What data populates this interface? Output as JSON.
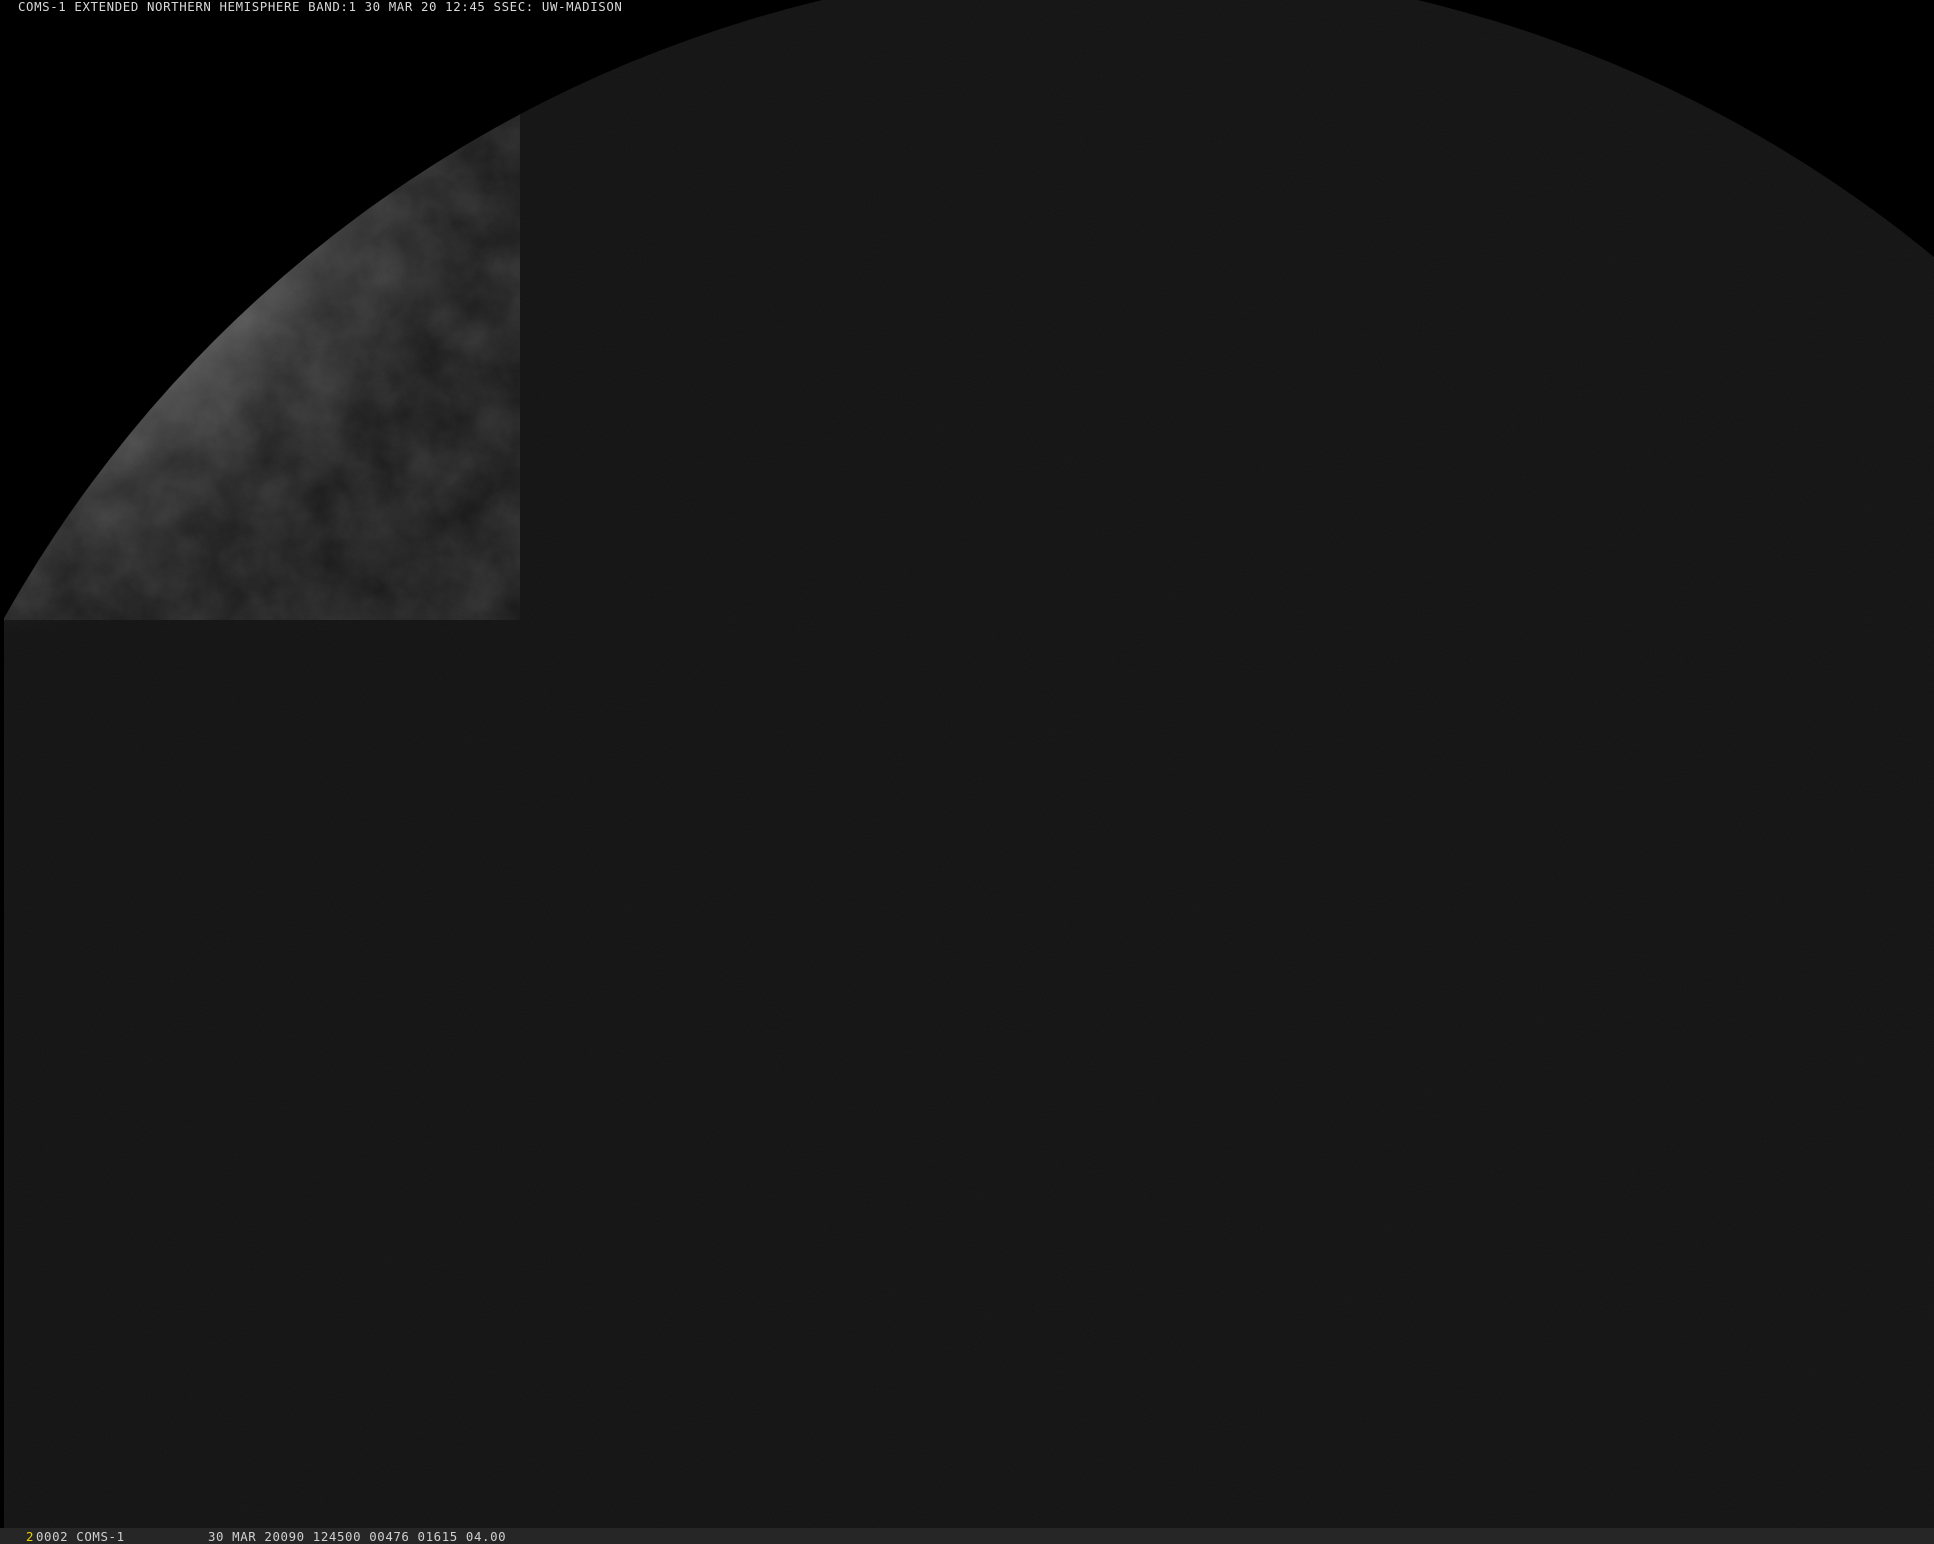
{
  "header": {
    "title": "COMS-1 EXTENDED NORTHERN HEMISPHERE BAND:1 30 MAR 20 12:45 SSEC: UW-MADISON"
  },
  "footer": {
    "frame_index": "2",
    "frame_id": "0002 COMS-1",
    "stats": "30 MAR 20090 124500 00476 01615 04.00"
  },
  "colors": {
    "background": "#000000",
    "disk_night": "#121212",
    "disk_day": "#8a8a8a",
    "footer_bar": "#262626",
    "frame_index_accent": "#e8d000"
  }
}
